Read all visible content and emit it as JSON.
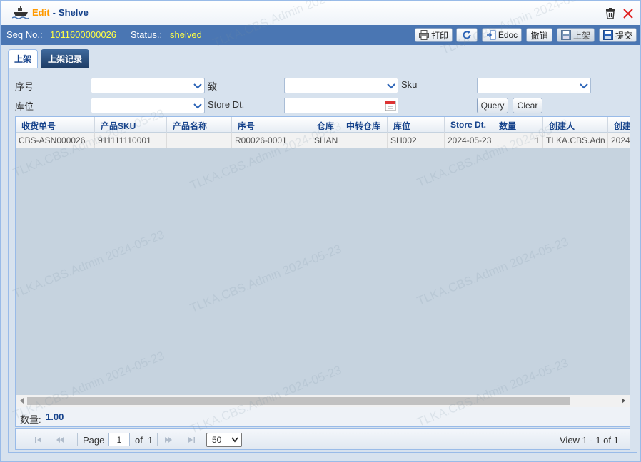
{
  "window": {
    "edit_label": "Edit",
    "separator": "-",
    "title": "Shelve"
  },
  "info": {
    "seq_label": "Seq No.:",
    "seq_value": "1011600000026",
    "status_label": "Status.:",
    "status_value": "shelved"
  },
  "toolbar": {
    "print": "打印",
    "edoc": "Edoc",
    "undo": "撤销",
    "shelve": "上架",
    "submit": "提交"
  },
  "tabs": [
    {
      "label": "上架",
      "active": true
    },
    {
      "label": "上架记录",
      "active": false
    }
  ],
  "filters": {
    "seq_label": "序号",
    "to_label": "致",
    "sku_label": "Sku",
    "location_label": "库位",
    "store_dt_label": "Store Dt.",
    "query_label": "Query",
    "clear_label": "Clear"
  },
  "grid": {
    "columns": [
      "收货单号",
      "产品SKU",
      "产品名称",
      "序号",
      "仓库",
      "中转仓库",
      "库位",
      "Store Dt.",
      "数量",
      "创建人",
      "创建"
    ],
    "rows": [
      [
        "CBS-ASN000026",
        "911111110001",
        "",
        "R00026-0001",
        "SHAN",
        "",
        "SH002",
        "2024-05-23",
        "1",
        "TLKA.CBS.Adn",
        "2024"
      ]
    ],
    "summary_label": "数量:",
    "summary_value": "1.00"
  },
  "pager": {
    "page_label": "Page",
    "page_value": "1",
    "of_label": "of",
    "total_pages": "1",
    "page_size": "50",
    "view_text": "View  1 - 1  of 1"
  },
  "watermark": "TLKA.CBS.Admin 2024-05-23",
  "colors": {
    "accent_blue": "#4a76b3",
    "highlight_yellow": "#ffff44",
    "edit_orange": "#ff9a00",
    "header_text": "#15428b",
    "close_red": "#e02020"
  },
  "icons": [
    "ship-icon",
    "trash-icon",
    "close-icon",
    "printer-icon",
    "refresh-icon",
    "edoc-icon",
    "save-icon",
    "calendar-icon",
    "chevron-down-icon",
    "first-page-icon",
    "prev-page-icon",
    "next-page-icon",
    "last-page-icon"
  ]
}
